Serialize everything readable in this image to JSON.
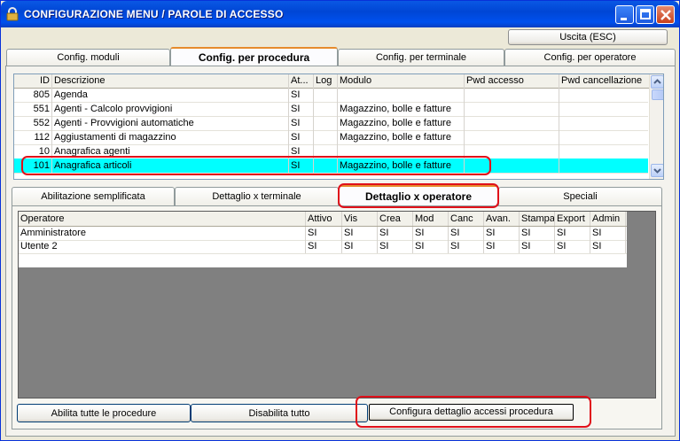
{
  "window": {
    "title": "CONFIGURAZIONE MENU / PAROLE DI ACCESSO"
  },
  "toolbar": {
    "exit_label": "Uscita (ESC)"
  },
  "main_tabs": [
    {
      "label": "Config. moduli"
    },
    {
      "label": "Config. per procedura"
    },
    {
      "label": "Config. per terminale"
    },
    {
      "label": "Config. per operatore"
    }
  ],
  "procedures": {
    "columns": [
      "ID",
      "Descrizione",
      "At...",
      "Log",
      "Modulo",
      "Pwd accesso",
      "Pwd cancellazione"
    ],
    "rows": [
      {
        "id": "805",
        "desc": "Agenda",
        "active": "SI",
        "log": "",
        "module": "",
        "pwd": "",
        "pwd_del": ""
      },
      {
        "id": "551",
        "desc": "Agenti - Calcolo provvigioni",
        "active": "SI",
        "log": "",
        "module": "Magazzino, bolle e fatture",
        "pwd": "",
        "pwd_del": ""
      },
      {
        "id": "552",
        "desc": "Agenti - Provvigioni automatiche",
        "active": "SI",
        "log": "",
        "module": "Magazzino, bolle e fatture",
        "pwd": "",
        "pwd_del": ""
      },
      {
        "id": "112",
        "desc": "Aggiustamenti di magazzino",
        "active": "SI",
        "log": "",
        "module": "Magazzino, bolle e fatture",
        "pwd": "",
        "pwd_del": ""
      },
      {
        "id": "10",
        "desc": "Anagrafica agenti",
        "active": "SI",
        "log": "",
        "module": "",
        "pwd": "",
        "pwd_del": ""
      },
      {
        "id": "101",
        "desc": "Anagrafica articoli",
        "active": "SI",
        "log": "",
        "module": "Magazzino, bolle e fatture",
        "pwd": "",
        "pwd_del": ""
      }
    ],
    "selected_index": 5
  },
  "sub_tabs": [
    {
      "label": "Abilitazione semplificata"
    },
    {
      "label": "Dettaglio x terminale"
    },
    {
      "label": "Dettaglio x operatore"
    },
    {
      "label": "Speciali"
    }
  ],
  "operators": {
    "columns": [
      "Operatore",
      "Attivo",
      "Vis",
      "Crea",
      "Mod",
      "Canc",
      "Avan.",
      "Stampa",
      "Export",
      "Admin"
    ],
    "rows": [
      {
        "name": "Amministratore",
        "vals": [
          "SI",
          "SI",
          "SI",
          "SI",
          "SI",
          "SI",
          "SI",
          "SI",
          "SI"
        ]
      },
      {
        "name": "Utente 2",
        "vals": [
          "SI",
          "SI",
          "SI",
          "SI",
          "SI",
          "SI",
          "SI",
          "SI",
          "SI"
        ]
      }
    ]
  },
  "buttons": {
    "enable_all": "Abilita tutte le procedure",
    "disable_all": "Disabilita tutto",
    "configure": "Configura dettaglio accessi procedura"
  },
  "colors": {
    "selected_row": "#00FFFF",
    "highlight": "#E0101A",
    "titlebar": "#0054E3"
  }
}
